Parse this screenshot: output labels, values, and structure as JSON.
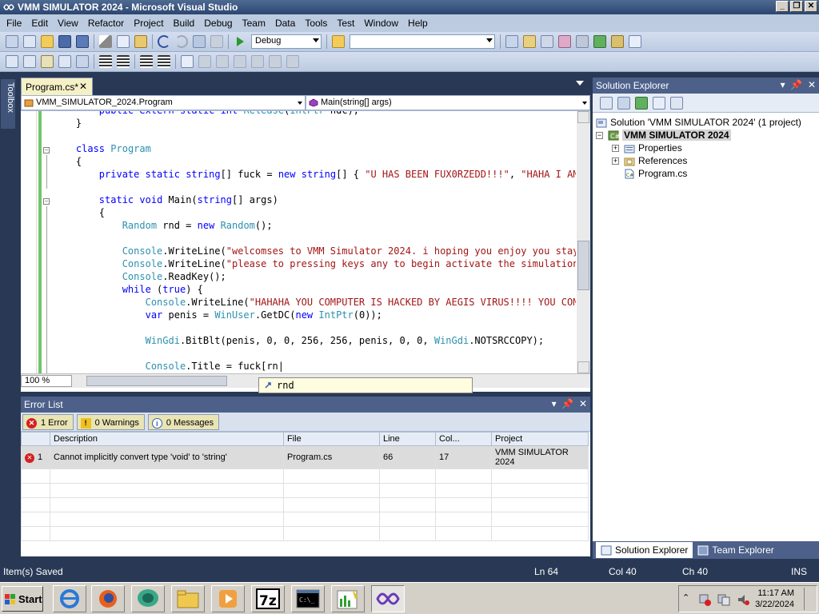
{
  "window": {
    "title": "VMM SIMULATOR 2024 - Microsoft Visual Studio",
    "controls": [
      "_",
      "❐",
      "✕"
    ]
  },
  "menu": [
    "File",
    "Edit",
    "View",
    "Refactor",
    "Project",
    "Build",
    "Debug",
    "Team",
    "Data",
    "Tools",
    "Test",
    "Window",
    "Help"
  ],
  "toolbar": {
    "config": "Debug",
    "platform": ""
  },
  "toolbox_label": "Toolbox",
  "editor": {
    "tab_label": "Program.cs*",
    "tab_close": "✕",
    "class_combo": "VMM_SIMULATOR_2024.Program",
    "member_combo": "Main(string[] args)",
    "zoom": "100 %",
    "intellisense_text": "rnd"
  },
  "error_list": {
    "title": "Error List",
    "errors_label": "1 Error",
    "warnings_label": "0 Warnings",
    "messages_label": "0 Messages",
    "columns": [
      "",
      "Description",
      "File",
      "Line",
      "Col...",
      "Project"
    ],
    "rows": [
      {
        "num": "1",
        "description": "Cannot implicitly convert type 'void' to 'string'",
        "file": "Program.cs",
        "line": "66",
        "col": "17",
        "project": "VMM SIMULATOR 2024"
      }
    ]
  },
  "solution_explorer": {
    "title": "Solution Explorer",
    "solution": "Solution 'VMM SIMULATOR 2024' (1 project)",
    "project": "VMM SIMULATOR 2024",
    "items": [
      "Properties",
      "References",
      "Program.cs"
    ],
    "tab_active": "Solution Explorer",
    "tab_other": "Team Explorer"
  },
  "status": {
    "message": "Item(s) Saved",
    "ln": "Ln 64",
    "col": "Col 40",
    "ch": "Ch 40",
    "mode": "INS"
  },
  "taskbar": {
    "start": "Start",
    "time": "11:17 AM",
    "date": "3/22/2024"
  },
  "colors": {
    "title_bar": "#2c4670",
    "ide_background": "#293955",
    "keyword": "#0000ff",
    "type": "#2b91af",
    "string": "#a31515",
    "error_icon": "#d42020"
  }
}
